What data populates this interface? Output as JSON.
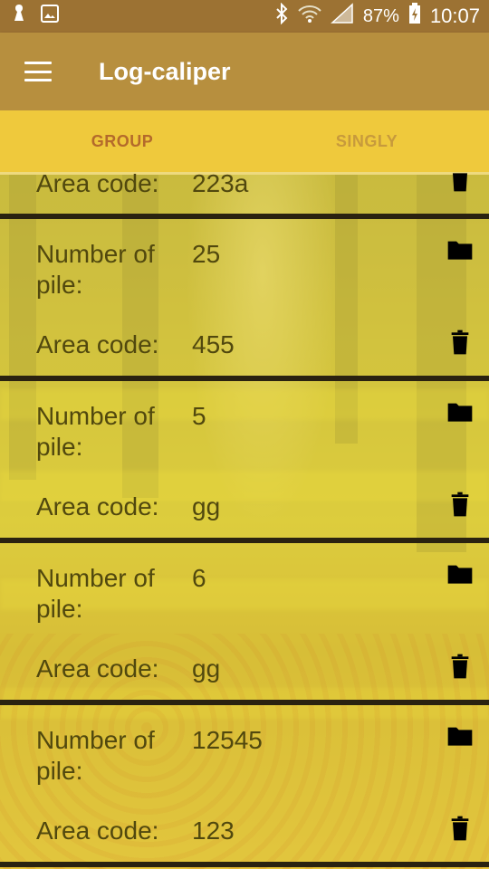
{
  "status_bar": {
    "battery": "87%",
    "time": "10:07"
  },
  "app_bar": {
    "title": "Log-caliper"
  },
  "tabs": [
    {
      "label": "GROUP",
      "active": true
    },
    {
      "label": "SINGLY",
      "active": false
    }
  ],
  "list": {
    "partial_item": {
      "area_label": "Area code:",
      "area_value": "223a"
    },
    "items": [
      {
        "pile_label": "Number of\npile:",
        "pile_value": "25",
        "area_label": "Area code:",
        "area_value": "455"
      },
      {
        "pile_label": "Number of\npile:",
        "pile_value": "5",
        "area_label": "Area code:",
        "area_value": "gg"
      },
      {
        "pile_label": "Number of\npile:",
        "pile_value": "6",
        "area_label": "Area code:",
        "area_value": "gg"
      },
      {
        "pile_label": "Number of\npile:",
        "pile_value": "12545",
        "area_label": "Area code:",
        "area_value": "123"
      }
    ]
  },
  "colors": {
    "statusbar": "#9c7233",
    "appbar": "#b78f3e",
    "tabbar": "#efc93c",
    "active_tab_text": "#b46a2b",
    "item_text": "#51480e"
  },
  "icons": [
    "menu-icon",
    "folder-icon",
    "trash-icon"
  ]
}
